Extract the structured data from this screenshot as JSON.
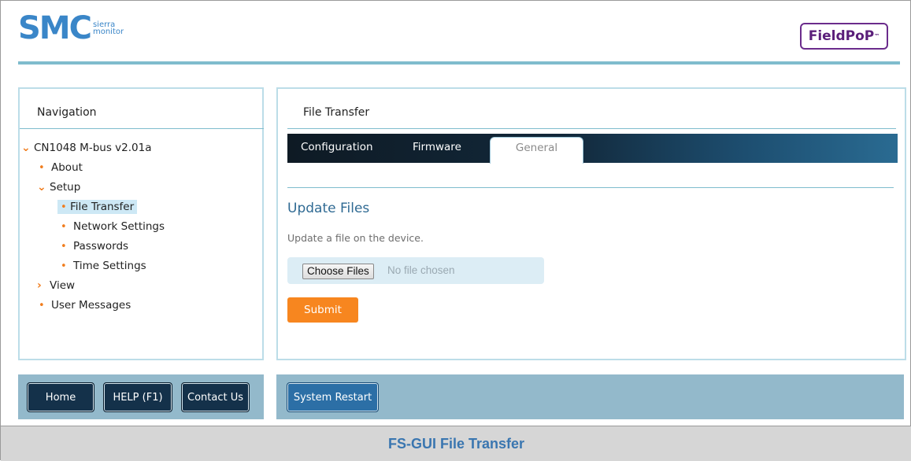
{
  "header": {
    "logo_main": "SMC",
    "logo_sub_line1": "sierra",
    "logo_sub_line2": "monitor",
    "product_badge": "FieldPoP",
    "product_badge_tm": "™"
  },
  "navigation": {
    "title": "Navigation",
    "root": "CN1048 M-bus v2.01a",
    "items": [
      {
        "label": "About",
        "type": "leaf"
      },
      {
        "label": "Setup",
        "type": "expanded"
      },
      {
        "label": "File Transfer",
        "type": "leaf",
        "selected": true
      },
      {
        "label": "Network Settings",
        "type": "leaf"
      },
      {
        "label": "Passwords",
        "type": "leaf"
      },
      {
        "label": "Time Settings",
        "type": "leaf"
      },
      {
        "label": "View",
        "type": "collapsed"
      },
      {
        "label": "User Messages",
        "type": "leaf"
      }
    ]
  },
  "content": {
    "title": "File Transfer",
    "tabs": [
      {
        "label": "Configuration",
        "active": false
      },
      {
        "label": "Firmware",
        "active": false
      },
      {
        "label": "General",
        "active": true
      }
    ],
    "section_title": "Update Files",
    "section_desc": "Update a file on the device.",
    "choose_button": "Choose Files",
    "no_file_text": "No file chosen",
    "submit_button": "Submit"
  },
  "footer": {
    "home": "Home",
    "help": "HELP (F1)",
    "contact": "Contact Us",
    "restart": "System Restart"
  },
  "caption": "FS-GUI File Transfer",
  "colors": {
    "accent_blue": "#3a86c8",
    "orange": "#f7861f",
    "panel_border": "#bcdde8",
    "footer_bg": "#93b9cb"
  },
  "icons": {
    "expanded": "chevron-down-icon",
    "collapsed": "chevron-right-icon",
    "bullet": "bullet-icon"
  }
}
